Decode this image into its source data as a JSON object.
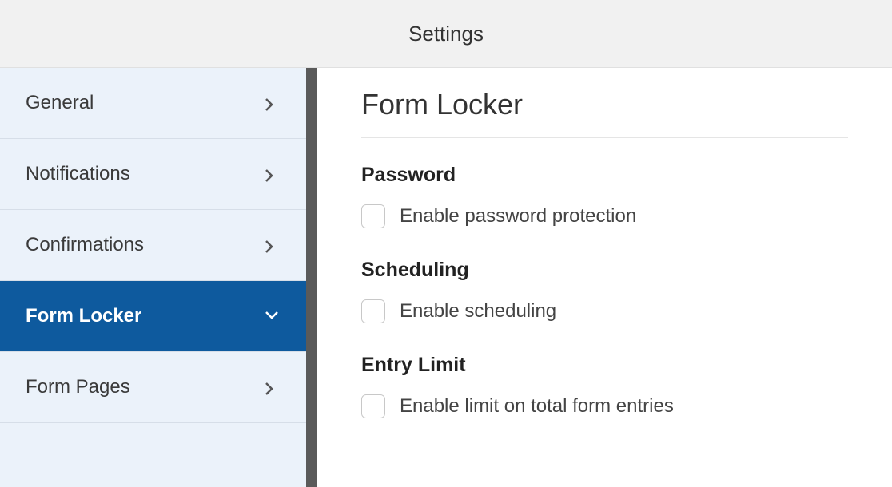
{
  "header": {
    "title": "Settings"
  },
  "sidebar": {
    "items": [
      {
        "label": "General",
        "active": false
      },
      {
        "label": "Notifications",
        "active": false
      },
      {
        "label": "Confirmations",
        "active": false
      },
      {
        "label": "Form Locker",
        "active": true
      },
      {
        "label": "Form Pages",
        "active": false
      }
    ]
  },
  "content": {
    "title": "Form Locker",
    "sections": [
      {
        "title": "Password",
        "checkbox_label": "Enable password protection"
      },
      {
        "title": "Scheduling",
        "checkbox_label": "Enable scheduling"
      },
      {
        "title": "Entry Limit",
        "checkbox_label": "Enable limit on total form entries"
      }
    ]
  }
}
